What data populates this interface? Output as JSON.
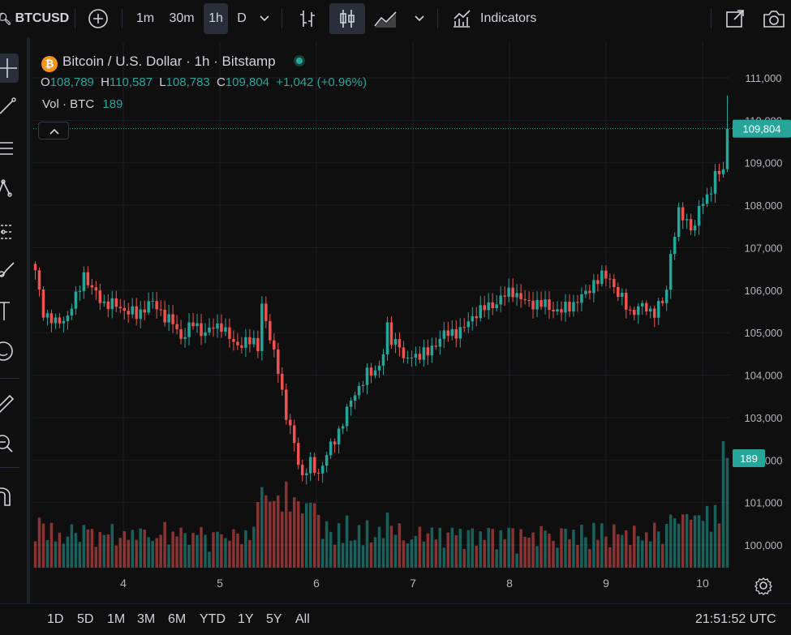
{
  "toolbar": {
    "symbol": "BTCUSD",
    "intervals": [
      "1m",
      "30m",
      "1h",
      "D"
    ],
    "active_interval": "1h",
    "indicators_label": "Indicators"
  },
  "legend": {
    "title": "Bitcoin / U.S. Dollar · 1h · Bitstamp",
    "coin_glyph": "₿",
    "o_label": "O",
    "o_value": "108,789",
    "h_label": "H",
    "h_value": "110,587",
    "l_label": "L",
    "l_value": "108,783",
    "c_label": "C",
    "c_value": "109,804",
    "change": "+1,042 (+0.96%)",
    "vol_label": "Vol · BTC",
    "vol_value": "189"
  },
  "price_axis": {
    "ticks": [
      "111,000",
      "110,000",
      "109,000",
      "108,000",
      "107,000",
      "106,000",
      "105,000",
      "104,000",
      "103,000",
      "102,000",
      "101,000",
      "100,000"
    ],
    "last_price_label": "109,804",
    "last_volume_label": "189"
  },
  "time_axis": {
    "ticks": [
      "4",
      "5",
      "6",
      "7",
      "8",
      "9",
      "10"
    ]
  },
  "bottom": {
    "ranges": [
      "1D",
      "5D",
      "1M",
      "3M",
      "6M",
      "YTD",
      "1Y",
      "5Y",
      "All"
    ],
    "clock": "21:51:52 UTC"
  },
  "colors": {
    "up": "#26a69a",
    "down": "#ef5350",
    "background": "#0f0f0f",
    "grid": "#1c1f26",
    "text": "#d1d4dc",
    "axis_text": "#b2b5be",
    "coin": "#f7931a"
  },
  "chart_data": {
    "type": "candlestick",
    "interval": "1h",
    "y_range": [
      99500,
      111500
    ],
    "x_ticks": [
      "4",
      "5",
      "6",
      "7",
      "8",
      "9",
      "10"
    ],
    "keyframes": [
      [
        0,
        106400
      ],
      [
        2,
        105500
      ],
      [
        5,
        105200
      ],
      [
        8,
        105400
      ],
      [
        10,
        105800
      ],
      [
        12,
        106400
      ],
      [
        14,
        106000
      ],
      [
        17,
        105700
      ],
      [
        21,
        105600
      ],
      [
        25,
        105400
      ],
      [
        28,
        105700
      ],
      [
        30,
        105600
      ],
      [
        34,
        105200
      ],
      [
        36,
        104900
      ],
      [
        39,
        105200
      ],
      [
        42,
        105000
      ],
      [
        46,
        105200
      ],
      [
        49,
        104700
      ],
      [
        52,
        104800
      ],
      [
        55,
        104700
      ],
      [
        56,
        105700
      ],
      [
        58,
        104800
      ],
      [
        60,
        104200
      ],
      [
        62,
        103000
      ],
      [
        64,
        102400
      ],
      [
        66,
        101600
      ],
      [
        68,
        101900
      ],
      [
        70,
        101700
      ],
      [
        73,
        102300
      ],
      [
        76,
        102900
      ],
      [
        79,
        103600
      ],
      [
        82,
        104000
      ],
      [
        84,
        104100
      ],
      [
        86,
        104500
      ],
      [
        87,
        105100
      ],
      [
        88,
        104800
      ],
      [
        90,
        104800
      ],
      [
        91,
        104300
      ],
      [
        94,
        104500
      ],
      [
        97,
        104500
      ],
      [
        100,
        104900
      ],
      [
        103,
        105000
      ],
      [
        106,
        105100
      ],
      [
        109,
        105500
      ],
      [
        112,
        105600
      ],
      [
        115,
        105800
      ],
      [
        118,
        106000
      ],
      [
        121,
        105700
      ],
      [
        124,
        105700
      ],
      [
        127,
        105600
      ],
      [
        130,
        105500
      ],
      [
        133,
        105700
      ],
      [
        136,
        105900
      ],
      [
        138,
        106200
      ],
      [
        140,
        106300
      ],
      [
        142,
        106300
      ],
      [
        144,
        105900
      ],
      [
        147,
        105500
      ],
      [
        150,
        105600
      ],
      [
        153,
        105500
      ],
      [
        155,
        105700
      ],
      [
        156,
        106000
      ],
      [
        157,
        106900
      ],
      [
        159,
        107800
      ],
      [
        161,
        107600
      ],
      [
        163,
        107500
      ],
      [
        164,
        107900
      ],
      [
        166,
        108200
      ],
      [
        168,
        108700
      ],
      [
        170,
        108780
      ],
      [
        171,
        109804
      ]
    ],
    "volume_scale": [
      0,
      420
    ],
    "last_close": 109804,
    "last_volume": 189
  }
}
